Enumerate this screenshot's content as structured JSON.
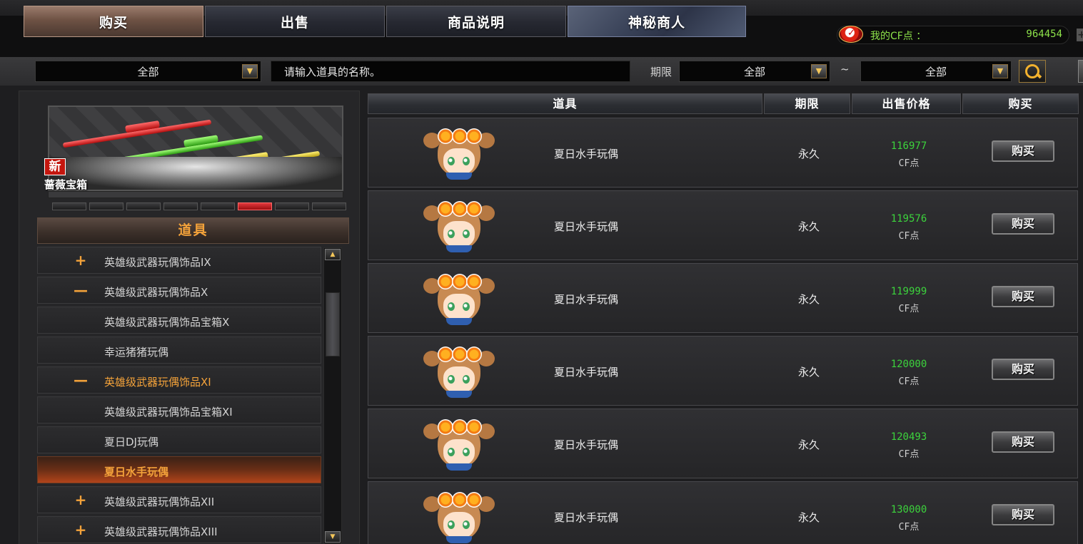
{
  "tabs": [
    {
      "label": "购买",
      "active": true
    },
    {
      "label": "出售",
      "active": false
    },
    {
      "label": "商品说明",
      "active": false
    },
    {
      "label": "神秘商人",
      "active": false
    }
  ],
  "cf": {
    "label": "我的CF点 ：",
    "value": "964454"
  },
  "filters": {
    "category": "全部",
    "search_placeholder": "请输入道具的名称。",
    "term_label": "期限",
    "term_from": "全部",
    "tilde": "~",
    "term_to": "全部"
  },
  "banner": {
    "badge": "新",
    "title": "蔷薇宝箱",
    "page_count": 8,
    "active_page": 6
  },
  "category_header": "道具",
  "categories": [
    {
      "symbol": "+",
      "label": "英雄级武器玩偶饰品IX"
    },
    {
      "symbol": "—",
      "label": "英雄级武器玩偶饰品X"
    },
    {
      "symbol": "",
      "label": "英雄级武器玩偶饰品宝箱X"
    },
    {
      "symbol": "",
      "label": "幸运猪猪玩偶"
    },
    {
      "symbol": "—",
      "label": "英雄级武器玩偶饰品XI"
    },
    {
      "symbol": "",
      "label": "英雄级武器玩偶饰品宝箱XI"
    },
    {
      "symbol": "",
      "label": "夏日DJ玩偶"
    },
    {
      "symbol": "",
      "label": "夏日水手玩偶"
    },
    {
      "symbol": "+",
      "label": "英雄级武器玩偶饰品XII"
    },
    {
      "symbol": "+",
      "label": "英雄级武器玩偶饰品XIII"
    }
  ],
  "table": {
    "headers": {
      "item": "道具",
      "term": "期限",
      "price": "出售价格",
      "buy": "购买"
    },
    "rows": [
      {
        "name": "夏日水手玩偶",
        "term": "永久",
        "price": "116977",
        "unit": "CF点",
        "button": "购买"
      },
      {
        "name": "夏日水手玩偶",
        "term": "永久",
        "price": "119576",
        "unit": "CF点",
        "button": "购买"
      },
      {
        "name": "夏日水手玩偶",
        "term": "永久",
        "price": "119999",
        "unit": "CF点",
        "button": "购买"
      },
      {
        "name": "夏日水手玩偶",
        "term": "永久",
        "price": "120000",
        "unit": "CF点",
        "button": "购买"
      },
      {
        "name": "夏日水手玩偶",
        "term": "永久",
        "price": "120493",
        "unit": "CF点",
        "button": "购买"
      },
      {
        "name": "夏日水手玩偶",
        "term": "永久",
        "price": "130000",
        "unit": "CF点",
        "button": "购买"
      }
    ]
  },
  "colors": {
    "accent_orange": "#f3a23a",
    "price_green": "#3cd33c",
    "cf_green": "#8de24a",
    "active_tab": "#6e5244"
  },
  "icons": {
    "cf_badge": "cf-points-icon",
    "search": "search-icon",
    "dropdown": "chevron-down-icon",
    "item": "sailor-doll-icon"
  }
}
